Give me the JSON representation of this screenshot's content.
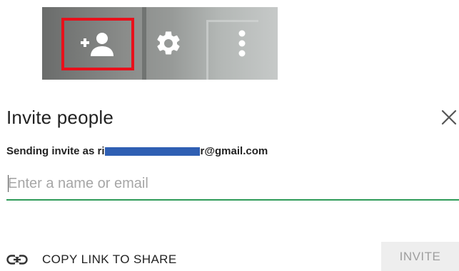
{
  "toolbar": {
    "icons": [
      "add-person-icon",
      "gear-icon",
      "more-vert-icon"
    ],
    "highlight_color": "#e8101b"
  },
  "dialog": {
    "title": "Invite people",
    "sender_prefix": "Sending invite as ri",
    "sender_suffix": "r@gmail.com",
    "email_placeholder": "Enter a name or email",
    "email_value": "",
    "copy_link_label": "COPY LINK TO SHARE",
    "invite_label": "INVITE",
    "accent_color": "#2e9b58",
    "redaction_color": "#2f5fb3"
  }
}
